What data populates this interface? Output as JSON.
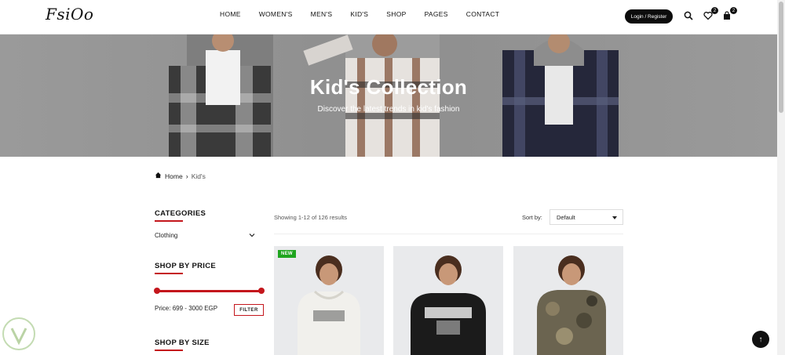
{
  "header": {
    "logo": "FsiOo",
    "nav": [
      "HOME",
      "WOMEN'S",
      "MEN'S",
      "KID'S",
      "SHOP",
      "PAGES",
      "CONTACT"
    ],
    "login_label": "Login / Register",
    "wishlist_count": "2",
    "cart_count": "2"
  },
  "hero": {
    "title": "Kid's Collection",
    "subtitle": "Discover the latest trends in kid's fashion"
  },
  "breadcrumb": {
    "home": "Home",
    "current": "Kid's"
  },
  "sidebar": {
    "categories_title": "CATEGORIES",
    "category_item": "Clothing",
    "price_title": "SHOP BY PRICE",
    "price_label": "Price:",
    "price_min": "699",
    "price_sep": "-",
    "price_max": "3000",
    "currency": "EGP",
    "filter_label": "FILTER",
    "size_title": "SHOP BY SIZE"
  },
  "listing": {
    "results_text": "Showing 1-12 of 126 results",
    "sort_label": "Sort by:",
    "sort_value": "Default"
  },
  "products": [
    {
      "badge": "NEW",
      "hoodie_color": "#f1f0ec",
      "print": "SAYHONG"
    },
    {
      "badge": "",
      "hoodie_color": "#1b1b1b",
      "print": "LEGENDS"
    },
    {
      "badge": "",
      "hoodie_color": "#6b6450",
      "print": ""
    }
  ],
  "colors": {
    "accent": "#c4161c",
    "new_badge": "#1fa51f",
    "dark": "#0c0c0c"
  }
}
